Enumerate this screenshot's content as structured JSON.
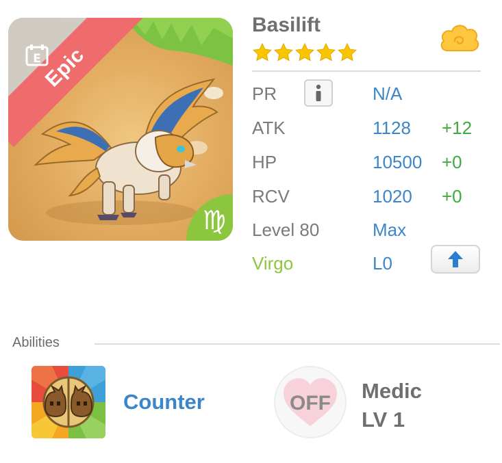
{
  "card": {
    "rarity": "Epic",
    "zodiac_symbol": "♍",
    "name": "Basilift",
    "stars": 5
  },
  "stats": [
    {
      "label": "PR",
      "value": "N/A",
      "bonus": ""
    },
    {
      "label": "ATK",
      "value": "1128",
      "bonus": "+12"
    },
    {
      "label": "HP",
      "value": "10500",
      "bonus": "+0"
    },
    {
      "label": "RCV",
      "value": "1020",
      "bonus": "+0"
    },
    {
      "label": "Level 80",
      "value": "Max",
      "bonus": ""
    },
    {
      "label": "Virgo",
      "value": "L0",
      "bonus": ""
    }
  ],
  "abilities": {
    "title": "Abilities",
    "primary": {
      "name": "Counter"
    },
    "secondary": {
      "status": "OFF",
      "name": "Medic",
      "level": "LV 1"
    }
  },
  "colors": {
    "accent_blue": "#3b86c8",
    "bonus_green": "#3fab3f",
    "zodiac_green": "#8cc63f",
    "rarity_red": "#ef6c6c",
    "star_yellow": "#f7c600"
  },
  "icons": {
    "info": "info-icon",
    "upgrade": "arrow-up-icon",
    "element": "cloud-icon",
    "card_detail": "document-icon"
  }
}
